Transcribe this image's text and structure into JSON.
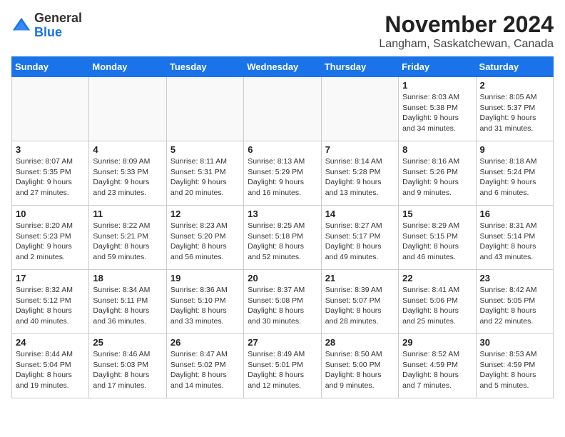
{
  "header": {
    "logo_line1": "General",
    "logo_line2": "Blue",
    "month": "November 2024",
    "location": "Langham, Saskatchewan, Canada"
  },
  "weekdays": [
    "Sunday",
    "Monday",
    "Tuesday",
    "Wednesday",
    "Thursday",
    "Friday",
    "Saturday"
  ],
  "weeks": [
    [
      {
        "day": "",
        "info": ""
      },
      {
        "day": "",
        "info": ""
      },
      {
        "day": "",
        "info": ""
      },
      {
        "day": "",
        "info": ""
      },
      {
        "day": "",
        "info": ""
      },
      {
        "day": "1",
        "info": "Sunrise: 8:03 AM\nSunset: 5:38 PM\nDaylight: 9 hours\nand 34 minutes."
      },
      {
        "day": "2",
        "info": "Sunrise: 8:05 AM\nSunset: 5:37 PM\nDaylight: 9 hours\nand 31 minutes."
      }
    ],
    [
      {
        "day": "3",
        "info": "Sunrise: 8:07 AM\nSunset: 5:35 PM\nDaylight: 9 hours\nand 27 minutes."
      },
      {
        "day": "4",
        "info": "Sunrise: 8:09 AM\nSunset: 5:33 PM\nDaylight: 9 hours\nand 23 minutes."
      },
      {
        "day": "5",
        "info": "Sunrise: 8:11 AM\nSunset: 5:31 PM\nDaylight: 9 hours\nand 20 minutes."
      },
      {
        "day": "6",
        "info": "Sunrise: 8:13 AM\nSunset: 5:29 PM\nDaylight: 9 hours\nand 16 minutes."
      },
      {
        "day": "7",
        "info": "Sunrise: 8:14 AM\nSunset: 5:28 PM\nDaylight: 9 hours\nand 13 minutes."
      },
      {
        "day": "8",
        "info": "Sunrise: 8:16 AM\nSunset: 5:26 PM\nDaylight: 9 hours\nand 9 minutes."
      },
      {
        "day": "9",
        "info": "Sunrise: 8:18 AM\nSunset: 5:24 PM\nDaylight: 9 hours\nand 6 minutes."
      }
    ],
    [
      {
        "day": "10",
        "info": "Sunrise: 8:20 AM\nSunset: 5:23 PM\nDaylight: 9 hours\nand 2 minutes."
      },
      {
        "day": "11",
        "info": "Sunrise: 8:22 AM\nSunset: 5:21 PM\nDaylight: 8 hours\nand 59 minutes."
      },
      {
        "day": "12",
        "info": "Sunrise: 8:23 AM\nSunset: 5:20 PM\nDaylight: 8 hours\nand 56 minutes."
      },
      {
        "day": "13",
        "info": "Sunrise: 8:25 AM\nSunset: 5:18 PM\nDaylight: 8 hours\nand 52 minutes."
      },
      {
        "day": "14",
        "info": "Sunrise: 8:27 AM\nSunset: 5:17 PM\nDaylight: 8 hours\nand 49 minutes."
      },
      {
        "day": "15",
        "info": "Sunrise: 8:29 AM\nSunset: 5:15 PM\nDaylight: 8 hours\nand 46 minutes."
      },
      {
        "day": "16",
        "info": "Sunrise: 8:31 AM\nSunset: 5:14 PM\nDaylight: 8 hours\nand 43 minutes."
      }
    ],
    [
      {
        "day": "17",
        "info": "Sunrise: 8:32 AM\nSunset: 5:12 PM\nDaylight: 8 hours\nand 40 minutes."
      },
      {
        "day": "18",
        "info": "Sunrise: 8:34 AM\nSunset: 5:11 PM\nDaylight: 8 hours\nand 36 minutes."
      },
      {
        "day": "19",
        "info": "Sunrise: 8:36 AM\nSunset: 5:10 PM\nDaylight: 8 hours\nand 33 minutes."
      },
      {
        "day": "20",
        "info": "Sunrise: 8:37 AM\nSunset: 5:08 PM\nDaylight: 8 hours\nand 30 minutes."
      },
      {
        "day": "21",
        "info": "Sunrise: 8:39 AM\nSunset: 5:07 PM\nDaylight: 8 hours\nand 28 minutes."
      },
      {
        "day": "22",
        "info": "Sunrise: 8:41 AM\nSunset: 5:06 PM\nDaylight: 8 hours\nand 25 minutes."
      },
      {
        "day": "23",
        "info": "Sunrise: 8:42 AM\nSunset: 5:05 PM\nDaylight: 8 hours\nand 22 minutes."
      }
    ],
    [
      {
        "day": "24",
        "info": "Sunrise: 8:44 AM\nSunset: 5:04 PM\nDaylight: 8 hours\nand 19 minutes."
      },
      {
        "day": "25",
        "info": "Sunrise: 8:46 AM\nSunset: 5:03 PM\nDaylight: 8 hours\nand 17 minutes."
      },
      {
        "day": "26",
        "info": "Sunrise: 8:47 AM\nSunset: 5:02 PM\nDaylight: 8 hours\nand 14 minutes."
      },
      {
        "day": "27",
        "info": "Sunrise: 8:49 AM\nSunset: 5:01 PM\nDaylight: 8 hours\nand 12 minutes."
      },
      {
        "day": "28",
        "info": "Sunrise: 8:50 AM\nSunset: 5:00 PM\nDaylight: 8 hours\nand 9 minutes."
      },
      {
        "day": "29",
        "info": "Sunrise: 8:52 AM\nSunset: 4:59 PM\nDaylight: 8 hours\nand 7 minutes."
      },
      {
        "day": "30",
        "info": "Sunrise: 8:53 AM\nSunset: 4:59 PM\nDaylight: 8 hours\nand 5 minutes."
      }
    ]
  ]
}
